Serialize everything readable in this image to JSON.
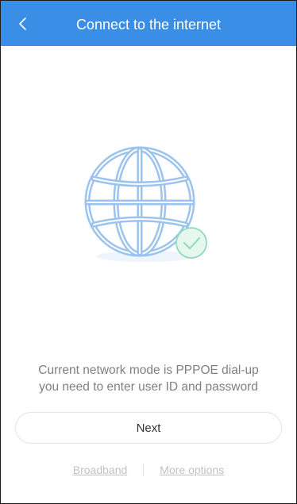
{
  "header": {
    "title": "Connect to the internet",
    "back_icon": "chevron-left-icon",
    "color": "#3a8ee6"
  },
  "illustration": {
    "globe_icon": "globe-icon",
    "check_icon": "check-badge-icon",
    "globe_color": "#9cc3ee",
    "check_color": "#8fdcb8"
  },
  "message": {
    "line1": "Current network mode is PPPOE dial-up",
    "line2": "you need to enter user ID and password"
  },
  "actions": {
    "next_label": "Next"
  },
  "links": {
    "broadband_label": "Broadband",
    "more_options_label": "More options"
  }
}
